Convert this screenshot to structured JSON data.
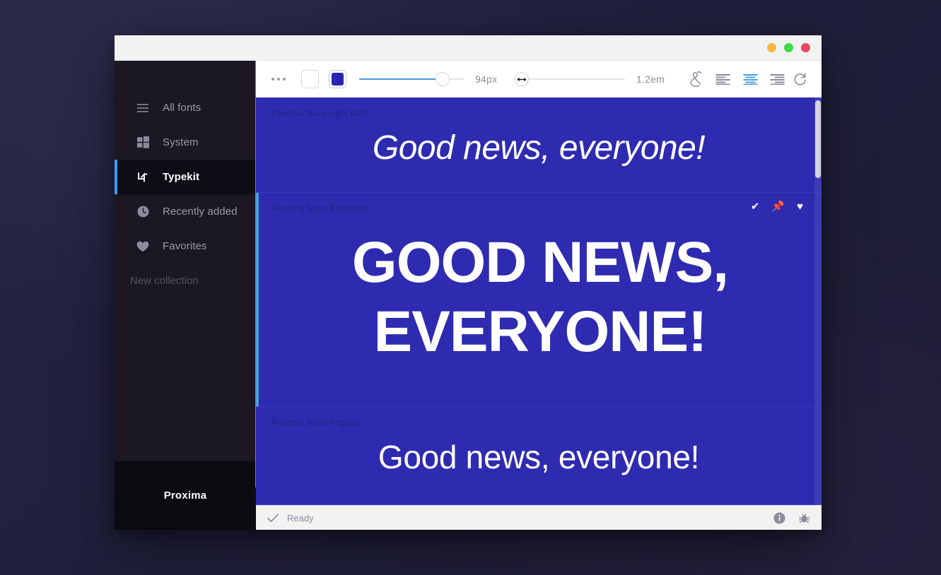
{
  "window": {
    "traffic_lights": [
      {
        "name": "minimize",
        "color": "#f3b942"
      },
      {
        "name": "maximize",
        "color": "#3ddc4a"
      },
      {
        "name": "close",
        "color": "#e8495f"
      }
    ]
  },
  "sidebar": {
    "items": [
      {
        "label": "All fonts",
        "icon": "hamburger-icon",
        "active": false
      },
      {
        "label": "System",
        "icon": "windows-icon",
        "active": false
      },
      {
        "label": "Typekit",
        "icon": "typekit-icon",
        "active": true
      },
      {
        "label": "Recently added",
        "icon": "clock-icon",
        "active": false
      },
      {
        "label": "Favorites",
        "icon": "heart-icon",
        "active": false
      }
    ],
    "new_collection_label": "New collection",
    "footer_label": "Proxima",
    "accent_color": "#3d9bf5",
    "background_color": "#1b1823",
    "footer_background": "#0c0a11"
  },
  "toolbar": {
    "more_icon": "ellipsis-icon",
    "swatches": [
      {
        "name": "color-swatch-white",
        "color": "#ffffff",
        "selected": false
      },
      {
        "name": "color-swatch-blue",
        "color": "#2a25b0",
        "selected": true
      }
    ],
    "font_size": {
      "value": "94px",
      "percent": 74,
      "label": "font-size-slider"
    },
    "line_height": {
      "value": "1.2em",
      "percent": 0,
      "label": "line-height-slider"
    },
    "ligature_icon": "ampersand-icon",
    "align": [
      {
        "name": "align-left-icon",
        "active": false
      },
      {
        "name": "align-center-icon",
        "active": true
      },
      {
        "name": "align-right-icon",
        "active": false
      }
    ],
    "reset_icon": "reset-icon",
    "accent_color": "#4a9ed6"
  },
  "preview": {
    "background_color": "#2e2bb0",
    "sample_text": "Good news, everyone!",
    "cards": [
      {
        "font_name": "Proxima Nova Light Italic",
        "text": "Good news, everyone!",
        "selected": false,
        "show_actions": false
      },
      {
        "font_name": "Proxima Nova Extrabold",
        "text": "Good news, everyone!",
        "selected": true,
        "show_actions": true,
        "actions": [
          {
            "name": "check-icon",
            "glyph": "✔"
          },
          {
            "name": "pin-icon",
            "glyph": "📌"
          },
          {
            "name": "heart-icon",
            "glyph": "♥"
          }
        ]
      },
      {
        "font_name": "Proxima Nova Regular",
        "text": "Good news, everyone!",
        "selected": false,
        "show_actions": false
      }
    ]
  },
  "statusbar": {
    "check_icon": "check-icon",
    "status_text": "Ready",
    "right_icons": [
      {
        "name": "info-icon"
      },
      {
        "name": "bug-icon"
      }
    ]
  }
}
